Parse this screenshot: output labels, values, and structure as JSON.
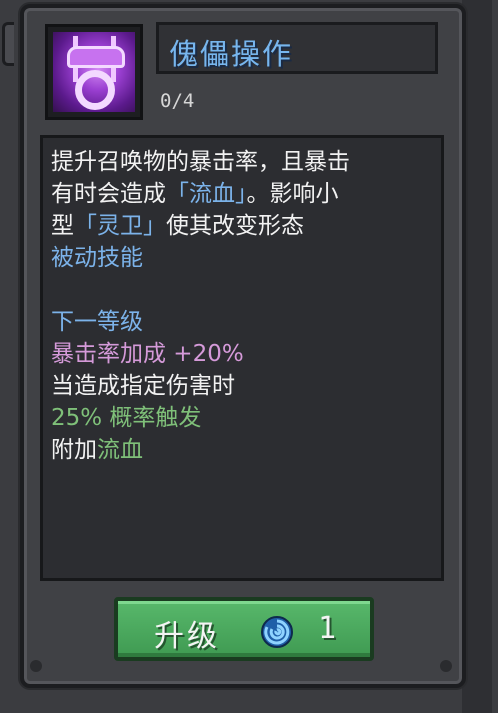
{
  "skill": {
    "title": "傀儡操作",
    "level": "0/4",
    "icon": "puppet-control-icon"
  },
  "description": {
    "line1": "提升召唤物的暴击率，且暴击",
    "line2_prefix": "有时会造成",
    "line2_highlight": "「流血」",
    "line2_suffix": "。影响小",
    "line3_prefix": "型",
    "line3_highlight": "「灵卫」",
    "line3_suffix": "使其改变形态",
    "passive": "被动技能"
  },
  "next_level": {
    "heading": "下一等级",
    "crit_bonus": "暴击率加成 +20%",
    "condition": "当造成指定伤害时",
    "chance": "25% 概率触发",
    "effect_prefix": "附加",
    "effect_highlight": "流血"
  },
  "upgrade": {
    "label": "升级",
    "currency_icon": "blue-gem-icon",
    "cost": "1"
  },
  "colors": {
    "title": "#77b6ee",
    "highlight_blue": "#7cb3ea",
    "pink": "#d59ad9",
    "green": "#7fc079",
    "button": "#4caa5e"
  }
}
